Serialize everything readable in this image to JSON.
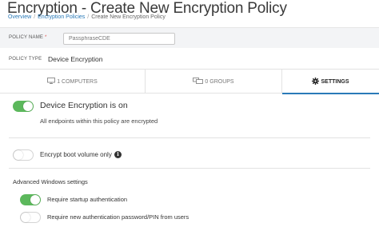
{
  "header": {
    "title": "Encryption - Create New Encryption Policy",
    "breadcrumb": [
      "Overview",
      "Encryption Policies",
      "Create New Encryption Policy"
    ],
    "breadcrumb_sep": "/"
  },
  "policy": {
    "name_label": "POLICY NAME",
    "required_mark": "*",
    "name_value": "PassphraseCDE",
    "type_label": "POLICY TYPE",
    "type_value": "Device Encryption"
  },
  "tabs": [
    {
      "label": "1 COMPUTERS",
      "icon": "monitor-icon",
      "active": false
    },
    {
      "label": "0 GROUPS",
      "icon": "monitors-group-icon",
      "active": false
    },
    {
      "label": "SETTINGS",
      "icon": "gear-icon",
      "active": true
    }
  ],
  "settings": {
    "encryption_title": "Device Encryption is on",
    "encryption_sub": "All endpoints within this policy are encrypted",
    "encryption_on": true,
    "boot_label": "Encrypt boot volume only",
    "boot_on": false,
    "info_glyph": "i",
    "advanced_title": "Advanced Windows settings",
    "options": [
      {
        "label": "Require startup authentication",
        "on": true
      },
      {
        "label": "Require new authentication password/PIN from users",
        "on": false
      }
    ]
  },
  "colors": {
    "accent": "#2a7ab8",
    "toggle_on": "#5cb85c"
  }
}
